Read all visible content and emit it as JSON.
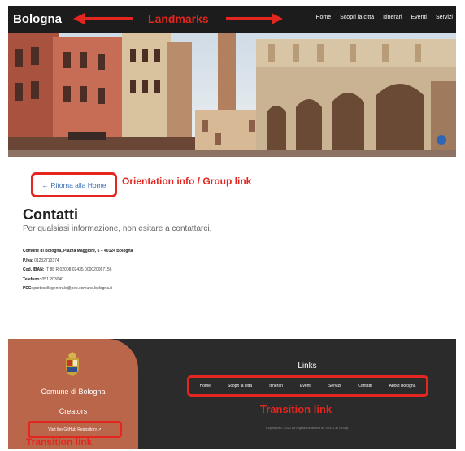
{
  "header": {
    "brand": "Bologna",
    "nav": [
      "Home",
      "Scopri la città",
      "Itinerari",
      "Eventi",
      "Servizi"
    ]
  },
  "annotations": {
    "landmarks": "Landmarks",
    "orientation": "Orientation info / Group link",
    "transition_center": "Transition link",
    "transition_bottom": "Transition link"
  },
  "main": {
    "back_link": "← Ritorna alla Home",
    "title": "Contatti",
    "subtitle": "Per qualsiasi informazione, non esitare a contattarci.",
    "address": "Comune di Bologna, Piazza Maggiore, 6 – 40124 Bologna",
    "details": [
      {
        "label": "P.Iva:",
        "value": "01232710374"
      },
      {
        "label": "Cod. IBAN:",
        "value": "IT 88 R 02008 02435 000020067156"
      },
      {
        "label": "Telefono:",
        "value": "051 203040"
      },
      {
        "label": "PEC:",
        "value": "protocollogenerale@pec.comune.bologna.it"
      }
    ]
  },
  "footer": {
    "org": "Comune di Bologna",
    "creators": "Creators",
    "github_link": "Visit the GitHub Repository ↗",
    "links_title": "Links",
    "links": [
      "Home",
      "Scopri la città",
      "Itinerari",
      "Eventi",
      "Servizi",
      "Contatti",
      "About Bologna"
    ],
    "copyright": "Copyright © 2022 All Rights Reserved by STELLM Group."
  },
  "colors": {
    "annotation": "#e3261f",
    "header_bg": "#1c1c1c",
    "footer_bg": "#2b2b2b",
    "footer_accent": "#b9664b",
    "link": "#3b6fb5"
  }
}
